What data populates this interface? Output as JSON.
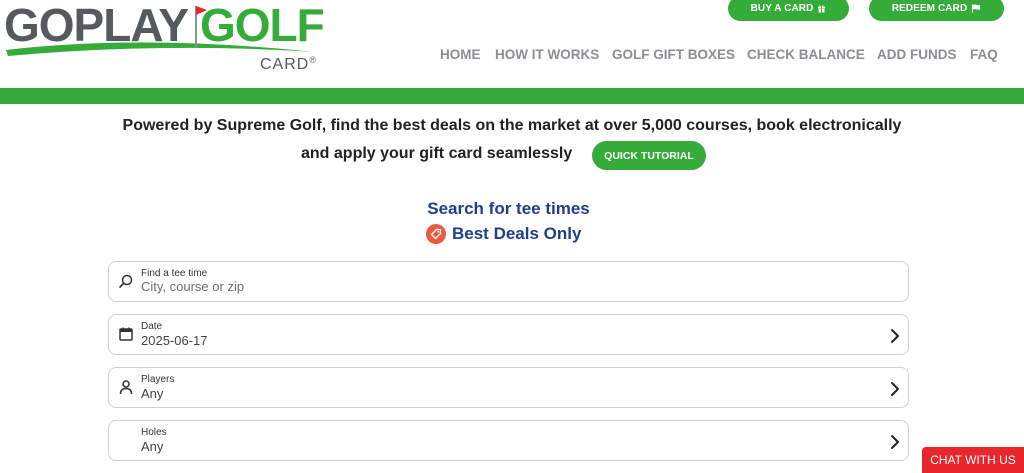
{
  "brand": {
    "logo_word1": "GOPLAY",
    "logo_word2": "GOLF",
    "logo_sub": "CARD",
    "logo_reg": "®",
    "colors": {
      "green": "#35ac3a",
      "gray": "#555a5f",
      "navy": "#1e3f8c",
      "flag_red": "#e8262b"
    }
  },
  "header": {
    "buy_card": "BUY A CARD",
    "redeem_card": "REDEEM CARD",
    "nav": [
      "HOME",
      "HOW IT WORKS",
      "GOLF GIFT BOXES",
      "CHECK BALANCE",
      "ADD FUNDS",
      "FAQ"
    ]
  },
  "intro": {
    "line1": "Powered by Supreme Golf, find the best deals on the market at over 5,000 courses, book electronically",
    "line2": "and apply your gift card seamlessly",
    "tutorial_button": "QUICK TUTORIAL"
  },
  "search": {
    "title": "Search for tee times",
    "deals_label": "Best Deals Only",
    "fields": {
      "location": {
        "label": "Find a tee time",
        "placeholder": "City, course or zip",
        "icon": "search-icon"
      },
      "date": {
        "label": "Date",
        "value": "2025-06-17",
        "icon": "calendar-icon"
      },
      "players": {
        "label": "Players",
        "value": "Any",
        "icon": "person-icon"
      },
      "holes": {
        "label": "Holes",
        "value": "Any"
      }
    }
  },
  "chat": {
    "label": "CHAT WITH US"
  }
}
